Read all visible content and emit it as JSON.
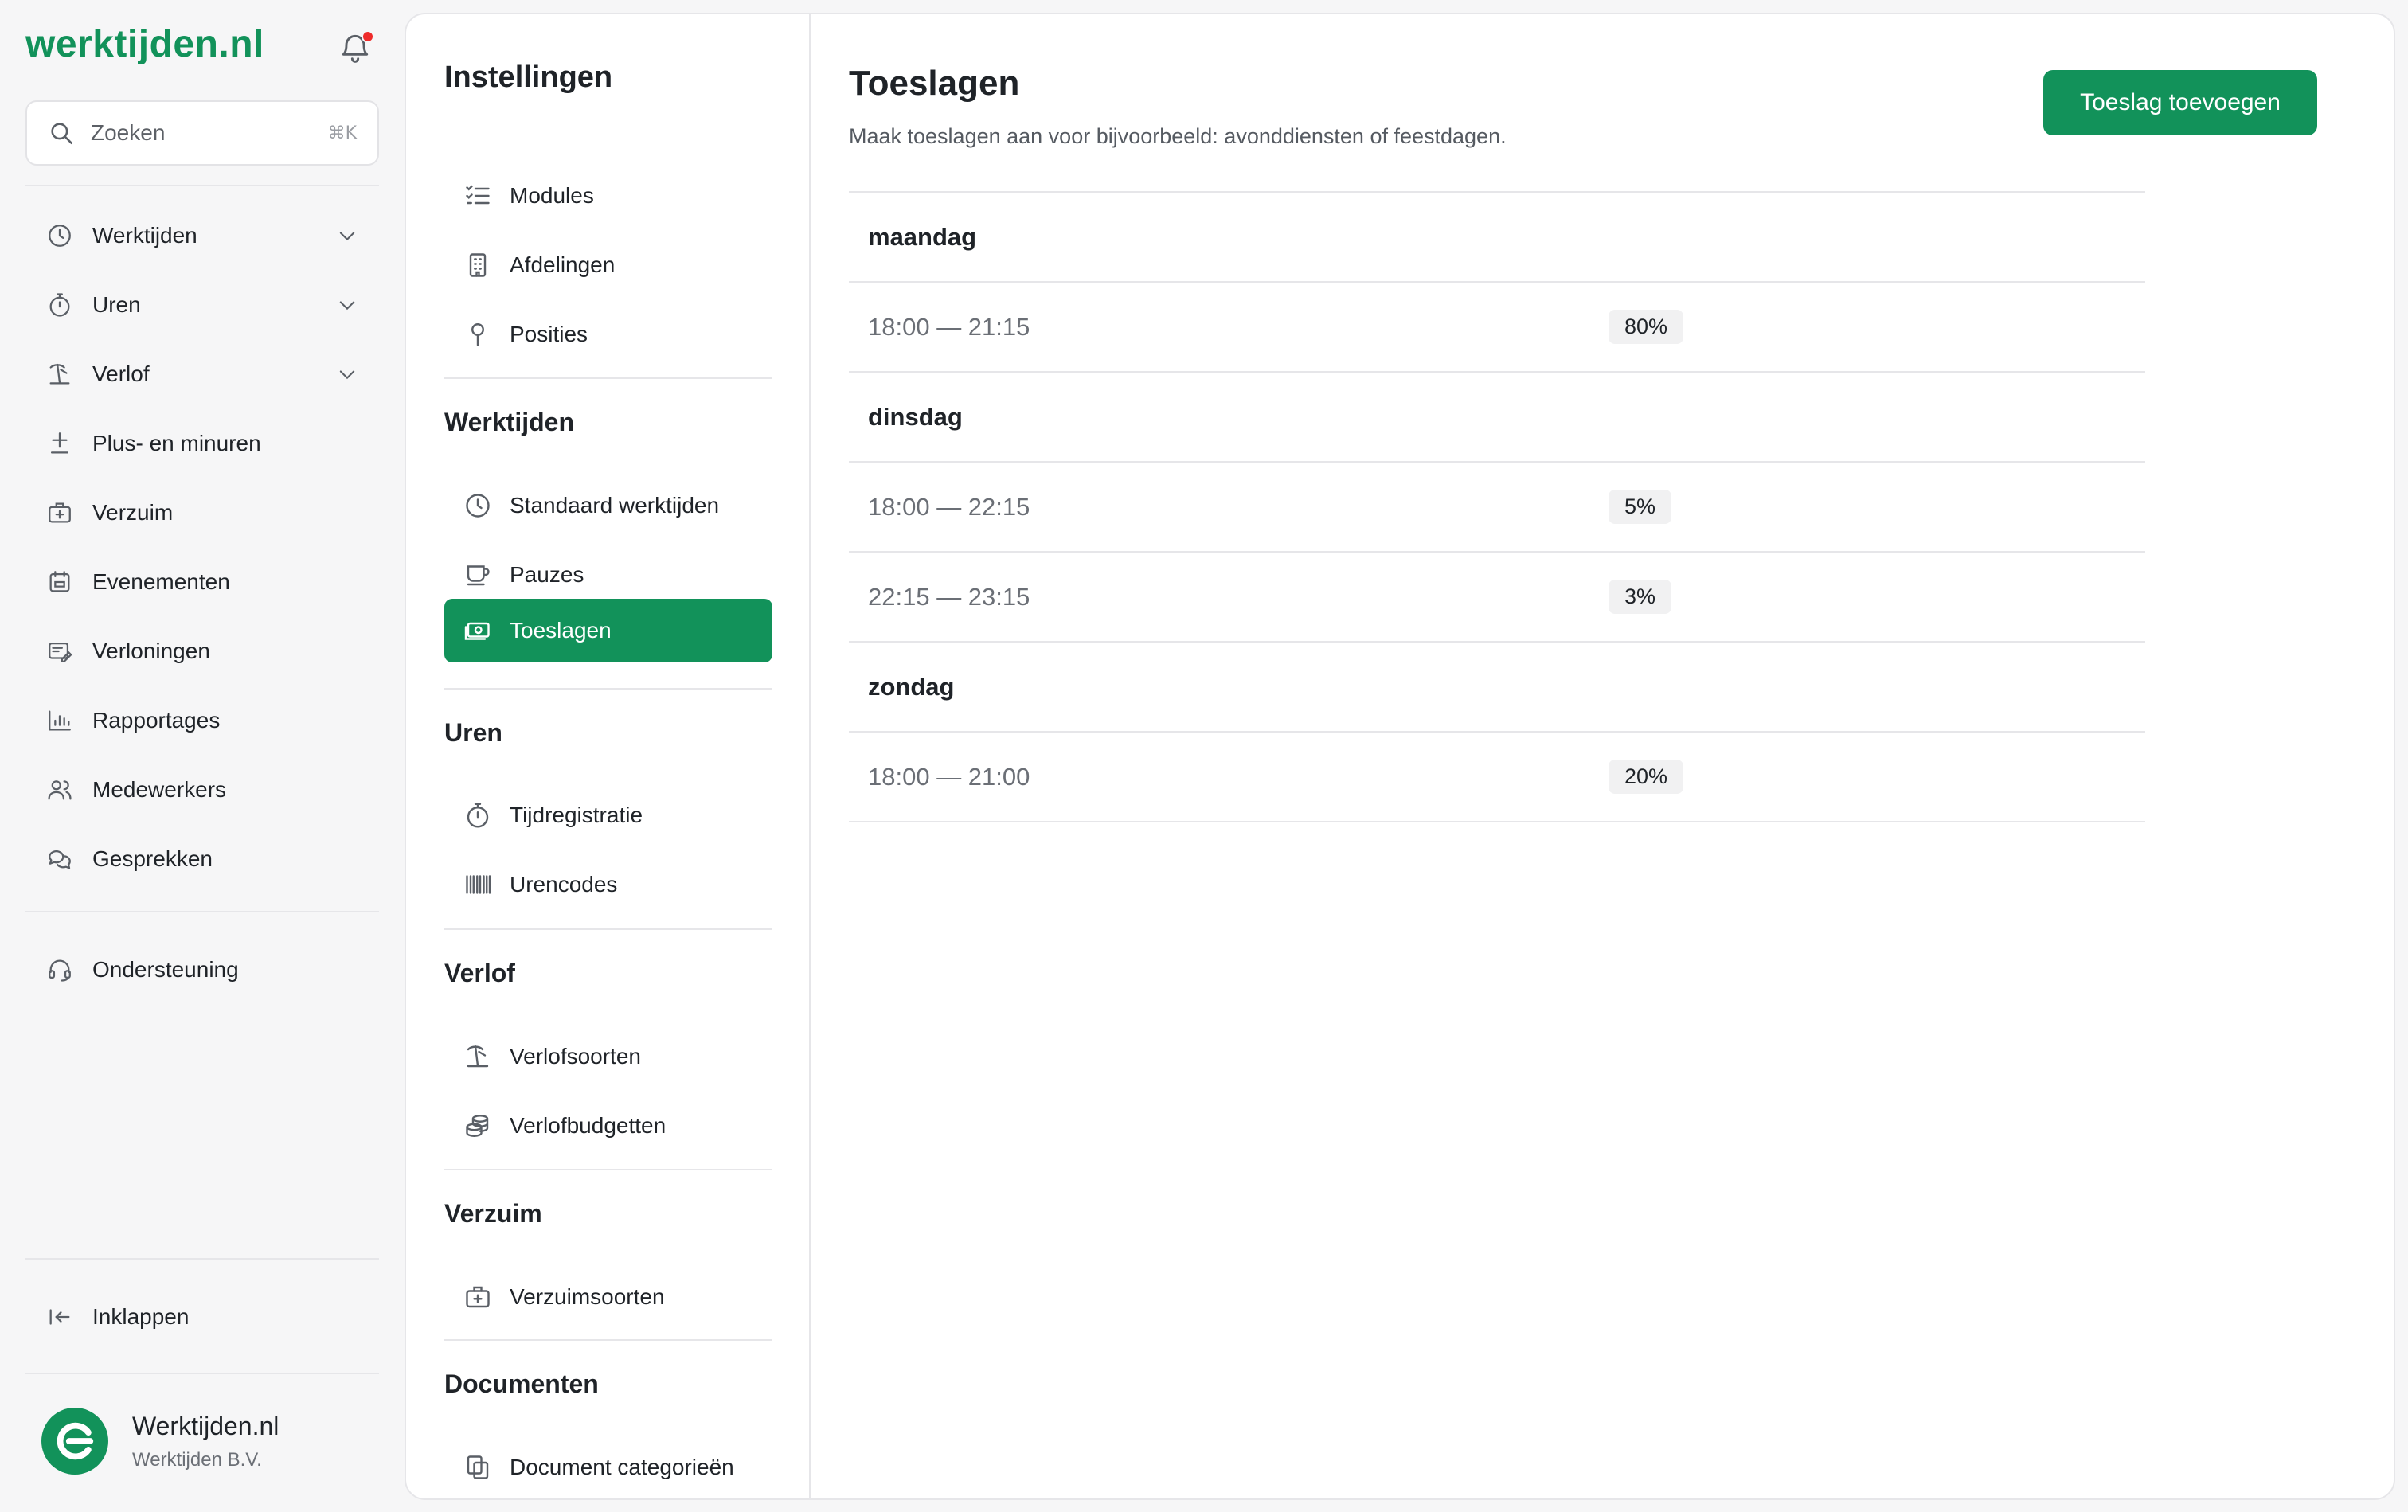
{
  "app": {
    "logo": "werktijden.nl"
  },
  "search": {
    "placeholder": "Zoeken",
    "shortcut": "⌘K"
  },
  "sidebar": {
    "items": [
      {
        "label": "Werktijden",
        "icon": "clock-icon",
        "expandable": true
      },
      {
        "label": "Uren",
        "icon": "stopwatch-icon",
        "expandable": true
      },
      {
        "label": "Verlof",
        "icon": "beach-icon",
        "expandable": true
      },
      {
        "label": "Plus- en minuren",
        "icon": "plus-minus-icon",
        "expandable": false
      },
      {
        "label": "Verzuim",
        "icon": "medkit-icon",
        "expandable": false
      },
      {
        "label": "Evenementen",
        "icon": "calendar-icon",
        "expandable": false
      },
      {
        "label": "Verloningen",
        "icon": "payslip-icon",
        "expandable": false
      },
      {
        "label": "Rapportages",
        "icon": "chart-icon",
        "expandable": false
      },
      {
        "label": "Medewerkers",
        "icon": "users-icon",
        "expandable": false
      },
      {
        "label": "Gesprekken",
        "icon": "chat-icon",
        "expandable": false
      }
    ],
    "support": "Ondersteuning",
    "collapse": "Inklappen",
    "profile": {
      "name": "Werktijden.nl",
      "org": "Werktijden B.V."
    }
  },
  "settings": {
    "title": "Instellingen",
    "general": [
      {
        "label": "Modules",
        "icon": "checklist-icon"
      },
      {
        "label": "Afdelingen",
        "icon": "building-icon"
      },
      {
        "label": "Posities",
        "icon": "pin-icon"
      }
    ],
    "groups": {
      "werktijden": {
        "title": "Werktijden",
        "items": [
          {
            "label": "Standaard werktijden",
            "icon": "clock-icon"
          },
          {
            "label": "Pauzes",
            "icon": "coffee-icon"
          },
          {
            "label": "Toeslagen",
            "icon": "money-icon"
          }
        ]
      },
      "uren": {
        "title": "Uren",
        "items": [
          {
            "label": "Tijdregistratie",
            "icon": "stopwatch-icon"
          },
          {
            "label": "Urencodes",
            "icon": "barcode-icon"
          }
        ]
      },
      "verlof": {
        "title": "Verlof",
        "items": [
          {
            "label": "Verlofsoorten",
            "icon": "beach-icon"
          },
          {
            "label": "Verlofbudgetten",
            "icon": "coins-icon"
          }
        ]
      },
      "verzuim": {
        "title": "Verzuim",
        "items": [
          {
            "label": "Verzuimsoorten",
            "icon": "medkit-icon"
          }
        ]
      },
      "documenten": {
        "title": "Documenten",
        "items": [
          {
            "label": "Document categorieën",
            "icon": "documents-icon"
          }
        ]
      }
    }
  },
  "main": {
    "title": "Toeslagen",
    "subtitle": "Maak toeslagen aan voor bijvoorbeeld: avonddiensten of feestdagen.",
    "add_button": "Toeslag toevoegen",
    "days": [
      {
        "day": "maandag",
        "entries": [
          {
            "time": "18:00 — 21:15",
            "pct": "80%"
          }
        ]
      },
      {
        "day": "dinsdag",
        "entries": [
          {
            "time": "18:00 — 22:15",
            "pct": "5%"
          },
          {
            "time": "22:15 — 23:15",
            "pct": "3%"
          }
        ]
      },
      {
        "day": "zondag",
        "entries": [
          {
            "time": "18:00 — 21:00",
            "pct": "20%"
          }
        ]
      }
    ]
  },
  "colors": {
    "accent": "#12925a",
    "notification": "#ef2b2b"
  }
}
